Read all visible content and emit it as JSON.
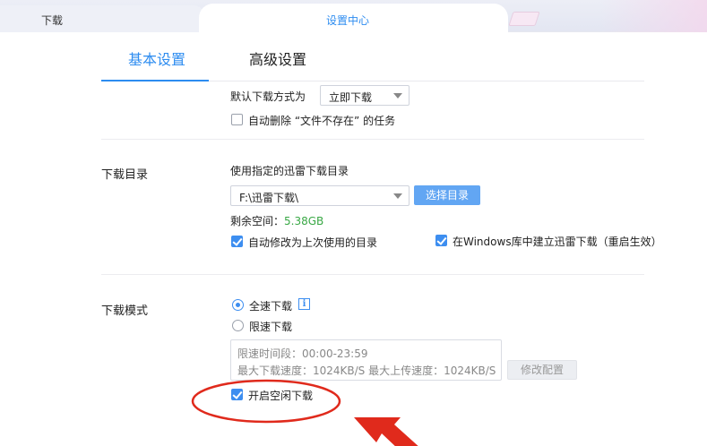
{
  "browser_tabs": {
    "downloads": "下载",
    "settings_center": "设置中心"
  },
  "settings_tabs": {
    "basic": "基本设置",
    "advanced": "高级设置"
  },
  "download_mode_default": {
    "label": "默认下载方式为",
    "select_value": "立即下载",
    "auto_delete_label": "自动删除 “文件不存在” 的任务",
    "auto_delete_checked": false
  },
  "download_dir": {
    "section_label": "下载目录",
    "use_dir_label": "使用指定的迅雷下载目录",
    "path_value": "F:\\迅雷下载\\",
    "choose_button": "选择目录",
    "free_space_label": "剩余空间：",
    "free_space_value": "5.38GB",
    "auto_modify_label": "自动修改为上次使用的目录",
    "auto_modify_checked": true,
    "windows_lib_label": "在Windows库中建立迅雷下载（重启生效）",
    "windows_lib_checked": true
  },
  "download_mode": {
    "section_label": "下载模式",
    "full_speed_label": "全速下载",
    "full_speed_selected": true,
    "limited_label": "限速下载",
    "limited_selected": false,
    "limit_period": "限速时间段：00:00-23:59",
    "limit_speeds": "最大下载速度：1024KB/S  最大上传速度：1024KB/S",
    "modify_button": "修改配置",
    "idle_download_label": "开启空闲下载",
    "idle_download_checked": true
  },
  "colors": {
    "accent": "#2d8cf0",
    "free_space": "#39a845",
    "annotation": "#e02a1c"
  },
  "icons": {
    "info": "info-icon",
    "caret": "chevron-down-icon"
  }
}
